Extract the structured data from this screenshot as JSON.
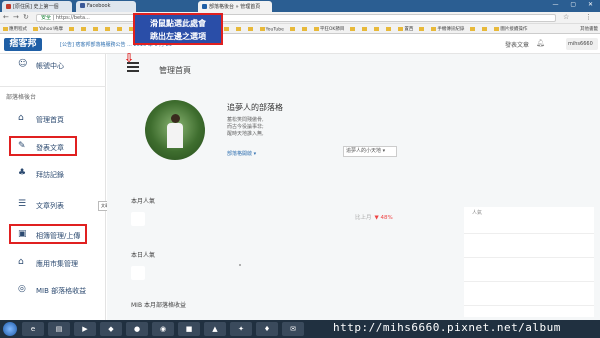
{
  "browser": {
    "tabs": [
      {
        "label": "[原住民] 史上第一個",
        "color": "#c0392b",
        "active": false
      },
      {
        "label": "Facebook",
        "color": "#3b5998",
        "active": false
      },
      {
        "label": "部落格後台 » 管理首頁",
        "color": "#1f5fa6",
        "active": true
      }
    ],
    "window_controls": "— ▢ ✕",
    "url_secure": "安全",
    "url_text": "https://beta...",
    "bookmarks": [
      "應用程式",
      "Yahoo!奇摩",
      "",
      "",
      "",
      "",
      "",
      "",
      "台中市公車",
      "",
      "",
      "",
      "",
      "",
      "",
      "",
      "YouTube",
      "",
      "",
      "平狂OK節目",
      "",
      "",
      "",
      "",
      "置西",
      "",
      "手機傳訊紀錄",
      "",
      "",
      "圖片接續操作"
    ],
    "other_bookmarks": "其他書籤"
  },
  "header": {
    "logo": "痞客邦",
    "notice": "[公告] 痞客邦部落格服務公告 ... 2016 年 6 月 29",
    "publish": "發表文章",
    "user": "mihs6660"
  },
  "sidebar": {
    "account": "帳號中心",
    "section": "部落格後台",
    "items": [
      {
        "icon": "home-icon",
        "glyph": "⌂",
        "label": "管理首頁"
      },
      {
        "icon": "edit-icon",
        "glyph": "✎",
        "label": "發表文章"
      },
      {
        "icon": "footprint-icon",
        "glyph": "♣",
        "label": "拜訪記錄"
      },
      {
        "icon": "list-icon",
        "glyph": "☰",
        "label": "文章列表"
      },
      {
        "icon": "image-icon",
        "glyph": "▣",
        "label": "相簿管理/上傳"
      },
      {
        "icon": "store-icon",
        "glyph": "⌂",
        "label": "應用市集管理"
      },
      {
        "icon": "coin-icon",
        "glyph": "◎",
        "label": "MIB 部落格收益"
      }
    ],
    "tooltip": "文章列表"
  },
  "main": {
    "title": "管理首頁",
    "annotation_line1": "滑鼠點選此處會",
    "annotation_line2": "跳出左邊之選項",
    "arrow": "⇩",
    "blog_name": "追夢人的部落格",
    "blog_desc": "蓄松笑問殘傲骨,\n而古今役論事非;\n醒時天地誰入無,",
    "blog_category": "部落格開啟 ▾",
    "blog_select": "追夢人的小天地 ▾",
    "stats": {
      "month_label": "本月人氣",
      "today_label": "本日人氣",
      "mib_label": "MIB 本月部落格收益",
      "compare_label": "比上月",
      "compare_value": "▼ 48%"
    },
    "chart_title": "人氣"
  },
  "watermark": "http://mihs6660.pixnet.net/album"
}
